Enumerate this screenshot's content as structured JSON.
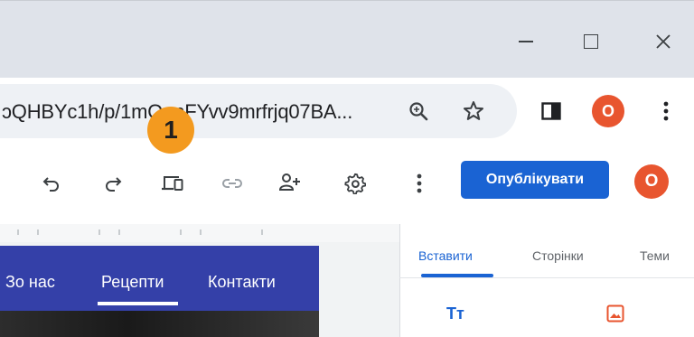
{
  "window": {
    "minimize_glyph": "—",
    "maximize_glyph": "☐",
    "close_glyph": "✕"
  },
  "browser": {
    "url": "ɔQHBYc1h/p/1mQ_nFYvv9mrfrjq07BA...",
    "zoom_icon": "zoom-icon",
    "bookmark_icon": "star-icon",
    "side_panel_icon": "side-panel-icon",
    "profile_initial": "O",
    "menu_icon": "kebab-menu-icon"
  },
  "editor_toolbar": {
    "undo_icon": "undo-icon",
    "redo_icon": "redo-icon",
    "preview_icon": "device-preview-icon",
    "link_icon": "link-icon",
    "share_icon": "add-person-icon",
    "settings_icon": "gear-icon",
    "more_icon": "kebab-menu-icon",
    "publish_label": "Опублікувати",
    "avatar_initial": "O"
  },
  "callout": {
    "number": "1"
  },
  "site_preview": {
    "nav": [
      "Про нас",
      "Рецепти",
      "Контакти"
    ],
    "active_index": 1,
    "visible_first": "Зо нас"
  },
  "side_panel": {
    "tabs": [
      "Вставити",
      "Сторінки",
      "Теми"
    ],
    "active_tab": 0,
    "text_box_glyph": "Tт",
    "image_icon": "image-icon"
  },
  "colors": {
    "accent": "#1a63d3",
    "nav_bg": "#3440a8",
    "marker": "#f39a1f",
    "avatar": "#e8552f"
  }
}
